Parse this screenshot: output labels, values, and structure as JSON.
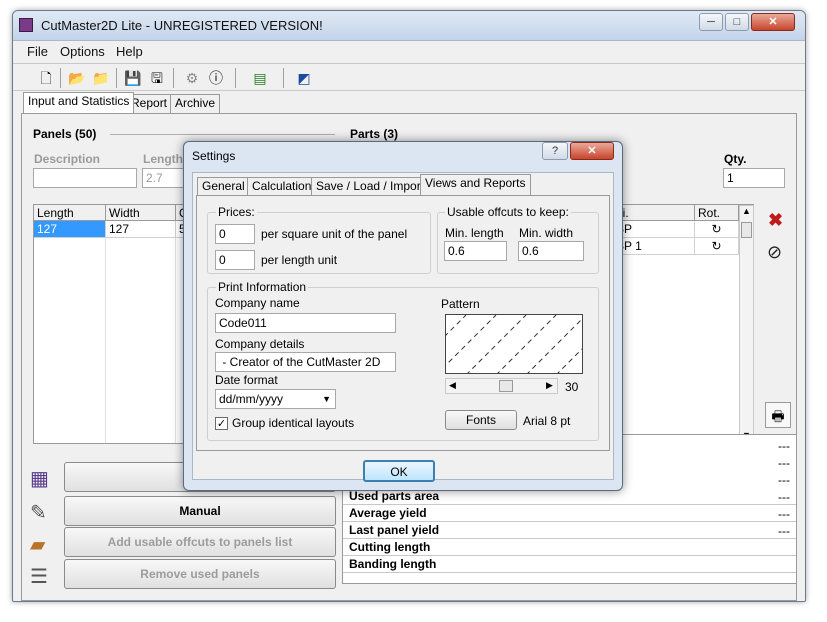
{
  "window": {
    "title": "CutMaster2D Lite - UNREGISTERED VERSION!",
    "min": "─",
    "max": "□",
    "close": "✕"
  },
  "menu": [
    "File",
    "Options",
    "Help"
  ],
  "tabs": [
    "Input and Statistics",
    "Report",
    "Archive"
  ],
  "panels": {
    "title": "Panels (50)",
    "description_label": "Description",
    "length_label": "Length",
    "length_value": "2.7",
    "grid_headers": [
      "Length",
      "Width",
      "Q"
    ],
    "grid_rows": [
      [
        "127",
        "127",
        "5"
      ]
    ]
  },
  "parts": {
    "title": "Parts (3)",
    "qty_label": "Qty.",
    "qty_value": "1",
    "grid_headers": [
      "ni.",
      "Rot."
    ],
    "grid_rows": [
      [
        "SP",
        "↻"
      ],
      [
        "SP 1",
        "↻"
      ]
    ]
  },
  "left_buttons": {
    "manual": "Manual",
    "add_offcuts": "Add usable offcuts to panels list",
    "remove_panels": "Remove used panels"
  },
  "stats": {
    "rows": [
      "Used parts area",
      "Average yield",
      "Last panel yield",
      "Cutting length",
      "Banding length"
    ],
    "dashes": "---"
  },
  "dialog": {
    "title": "Settings",
    "help": "?",
    "close": "✕",
    "tabs": [
      "General",
      "Calculation",
      "Save / Load / Import",
      "Views and Reports"
    ],
    "prices": {
      "title": "Prices:",
      "value1": "0",
      "label1": "per square unit of the panel",
      "value2": "0",
      "label2": "per length unit"
    },
    "offcuts": {
      "title": "Usable offcuts to keep:",
      "min_length_label": "Min. length",
      "min_length_value": "0.6",
      "min_width_label": "Min. width",
      "min_width_value": "0.6"
    },
    "print": {
      "title": "Print Information",
      "company_name_label": "Company name",
      "company_name_value": "Code011",
      "company_details_label": "Company details",
      "company_details_value": " - Creator of the CutMaster 2D",
      "date_format_label": "Date format",
      "date_format_value": "dd/mm/yyyy",
      "group_label": "Group identical layouts",
      "group_checked": true,
      "pattern_label": "Pattern",
      "pattern_value": "30",
      "fonts_button": "Fonts",
      "font_value": "Arial 8 pt"
    },
    "ok": "OK"
  }
}
